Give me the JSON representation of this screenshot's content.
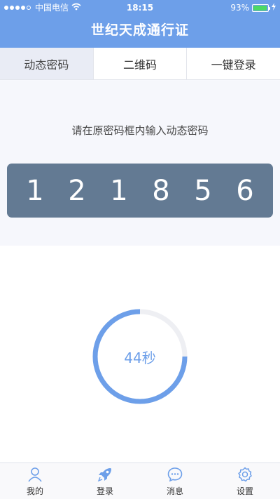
{
  "status": {
    "carrier": "中国电信",
    "time": "18:15",
    "battery": "93%",
    "wifi_icon": "wifi-icon",
    "battery_icon": "battery-icon"
  },
  "header": {
    "title": "世纪天成通行证"
  },
  "tabs": [
    {
      "label": "动态密码",
      "active": true
    },
    {
      "label": "二维码",
      "active": false
    },
    {
      "label": "一键登录",
      "active": false
    }
  ],
  "main": {
    "hint": "请在原密码框内输入动态密码",
    "code_digits": [
      "1",
      "2",
      "1",
      "8",
      "5",
      "6"
    ]
  },
  "timer": {
    "label": "44秒",
    "progress": 0.75,
    "colors": {
      "active": "#6d9fe9",
      "track": "#eeeff3"
    }
  },
  "bottom_nav": [
    {
      "label": "我的",
      "icon": "user-icon"
    },
    {
      "label": "登录",
      "icon": "rocket-icon"
    },
    {
      "label": "消息",
      "icon": "message-icon"
    },
    {
      "label": "设置",
      "icon": "gear-icon"
    }
  ],
  "colors": {
    "accent": "#6d9fe9",
    "code_box": "#637a93"
  }
}
